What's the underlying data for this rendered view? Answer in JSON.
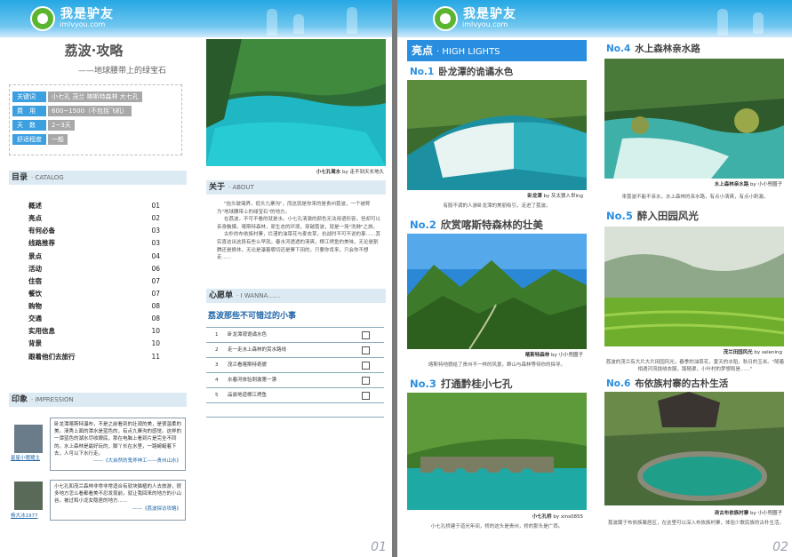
{
  "brand": {
    "name": "我是驴友",
    "url": "imlvyou.com"
  },
  "page1": {
    "title": "荔波·攻略",
    "subtitle": "——地球腰带上的绿宝石",
    "keywords": [
      {
        "key": "关键词",
        "value": "小七孔 茂兰 喀斯特森林 大七孔"
      },
      {
        "key": "费　用",
        "value": "600~1500（不包括飞机）"
      },
      {
        "key": "天　数",
        "value": "2~3天"
      },
      {
        "key": "舒适程度",
        "value": "一般"
      }
    ],
    "catalog_title": "目录",
    "catalog_en": "· CATALOG",
    "catalog": [
      {
        "label": "概述",
        "page": "01"
      },
      {
        "label": "亮点",
        "page": "02"
      },
      {
        "label": "有何必备",
        "page": "03"
      },
      {
        "label": "线路推荐",
        "page": "03"
      },
      {
        "label": "景点",
        "page": "04"
      },
      {
        "label": "活动",
        "page": "06"
      },
      {
        "label": "住宿",
        "page": "07"
      },
      {
        "label": "餐饮",
        "page": "07"
      },
      {
        "label": "购物",
        "page": "08"
      },
      {
        "label": "交通",
        "page": "08"
      },
      {
        "label": "实用信息",
        "page": "10"
      },
      {
        "label": "背景",
        "page": "10"
      },
      {
        "label": "跟着他们去旅行",
        "page": "11"
      }
    ],
    "impression_title": "印象",
    "impression_en": "· IMPRESSION",
    "impressions": [
      {
        "text": "卧龙潭喀斯特瀑布，不是之前看到的壮观的美，是很温柔的美。清秀上面的潭水是蓝色的，有点九寨沟的感觉。这样的一潭蓝色的湖水尽收眼底，那在电脑上看到片是完全不同的。水上森林是最好玩的，脚丫长在水里，一路蜿蜒着下去，人可以下水行走。",
        "source": "——《大自然的鬼斧神工——贵州山水》",
        "user": "星星小猪猪主"
      },
      {
        "text": "小七孔和茂兰森林非常非常适合有就块猫植的人去旅游，很多地方怎么看都看美不忍发现前，就让我回来的地方的小山谷，被过和小龙女隐居的地方……",
        "source": "——《荔波探访攻略》",
        "user": "杨大冰1977"
      }
    ],
    "photo_caption": "小七孔鸳水",
    "photo_credit": "by 走不到天长地久",
    "about_title": "关于",
    "about_en": "· ABOUT",
    "about_paragraphs": [
      "\"抬头玻璃界，低头九寨沟\"，而这就是你来的是贵州荔波，一个被称为\"地球腰带上的绿宝石\"的地方。",
      "在荔波，不可不看的就是水。小七孔清澈的颜色无法用语形容，但却可以亲身触摸。喀斯特森林，原生态的环境，穿越荔波，就是一场\"洗肺\"之旅。",
      "古朴的布依族村寨，烂漫的油菜花与麦衣草，抗战时不可不说的事……其实喜这出这段有些么早就。春水河透透的清爽，樟江烤鱼的美味，无论是割腾还是换休，无论是瀑着哪切还是寨下田的，只要你肯来，只会你不想走……"
    ],
    "wanna_title": "心愿单",
    "wanna_en": "· I WANNA……",
    "wanna_heading": "荔波那些不可错过的小事",
    "wanna_items": [
      {
        "n": "1",
        "text": "卧龙潭观诡谲水色"
      },
      {
        "n": "2",
        "text": "走一走水上森林的赏水路线"
      },
      {
        "n": "3",
        "text": "茂兰看喀斯特奇貌"
      },
      {
        "n": "4",
        "text": "水春河体验刺激第一漂"
      },
      {
        "n": "5",
        "text": "品尝地道樟江烤鱼"
      }
    ],
    "page_no": "01"
  },
  "page2": {
    "hl_title": "亮点",
    "hl_en": "· HIGH LIGHTS",
    "items": [
      {
        "no": "No.1",
        "title": "卧龙潭的诡谲水色",
        "cap": "卧龙潭",
        "credit": "by 灰太狼入世ing",
        "desc": "有股不调的人游卧龙潭的美丽吸引，走进了荔波。"
      },
      {
        "no": "No.2",
        "title": "欣赏喀斯特森林的壮美",
        "cap": "喀斯特森林",
        "credit": "by 小小兜圈子",
        "desc": "喀斯特地貌给了贵州不一样的风景，群山与森林等待你的探寻。"
      },
      {
        "no": "No.3",
        "title": "打通黔桂小七孔",
        "cap": "小七孔桥",
        "credit": "by xins0855",
        "desc": "小七孔桥建于道光年间，桥的这头是贵州，桥的那头是广西。"
      },
      {
        "no": "No.4",
        "title": "水上森林亲水路",
        "cap": "水上森林亲水路",
        "credit": "by 小小兜圈子",
        "desc": "来荔波不能不亲水，水上森林的亲水路，有点小清爽，有点小刺激。"
      },
      {
        "no": "No.5",
        "title": "醉入田园风光",
        "cap": "茂兰田园风光",
        "credit": "by selening",
        "desc": "荔波的茂兰有大片大片田园风光，春季的油菜花，夏天的水稻，秋日的玉米。\"随着相遇河流拢绕衣服，路随渠，小叶村的梦想和是……\""
      },
      {
        "no": "No.6",
        "title": "布依族村寨的古朴生活",
        "cap": "尧古布依族村寨",
        "credit": "by 小小兜圈子",
        "desc": "荔波属于布依族聚居区，在这里可以深入布依族村寨，体验少数民族的古朴生活。"
      }
    ],
    "page_no": "02"
  }
}
